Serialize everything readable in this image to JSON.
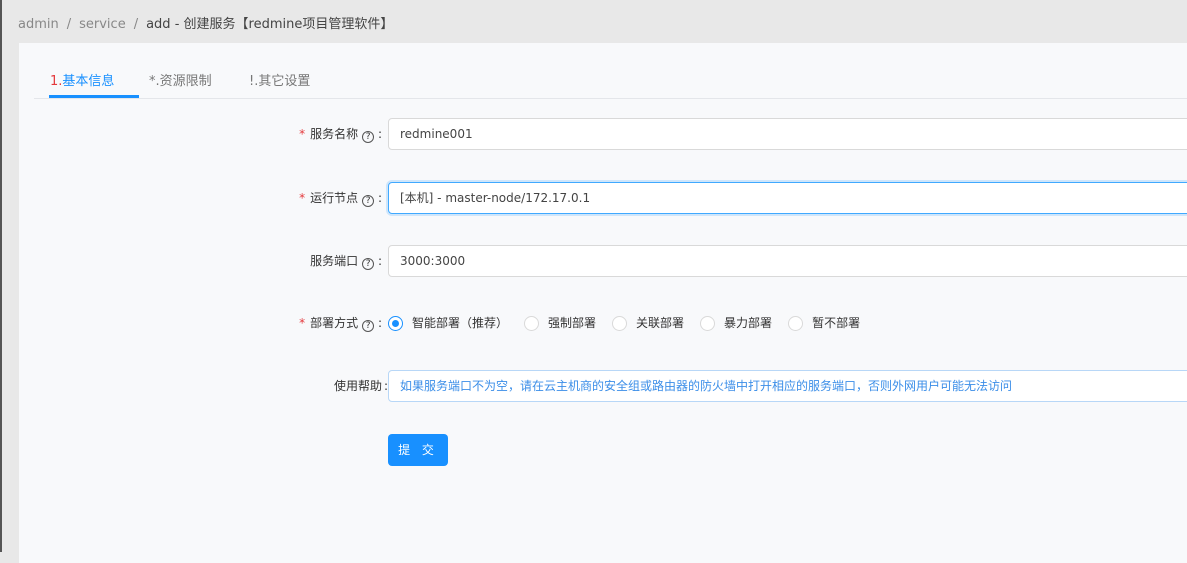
{
  "breadcrumb": {
    "items": [
      "admin",
      "service"
    ],
    "current": "add  -  创建服务【redmine项目管理软件】"
  },
  "tabs": [
    {
      "num": "1.",
      "label": "基本信息"
    },
    {
      "label": "*.资源限制"
    },
    {
      "label": "!.其它设置"
    }
  ],
  "form": {
    "service_name": {
      "label": "服务名称",
      "required": true,
      "value": "redmine001"
    },
    "node": {
      "label": "运行节点",
      "required": true,
      "value": "[本机] - master-node/172.17.0.1"
    },
    "port": {
      "label": "服务端口",
      "value": "3000:3000"
    },
    "deploy": {
      "label": "部署方式",
      "required": true,
      "options": [
        "智能部署（推荐）",
        "强制部署",
        "关联部署",
        "暴力部署",
        "暂不部署"
      ],
      "selected": "智能部署（推荐）"
    },
    "help": {
      "label": "使用帮助",
      "text": "如果服务端口不为空，请在云主机商的安全组或路由器的防火墙中打开相应的服务端口，否则外网用户可能无法访问"
    },
    "submit": "提 交"
  },
  "colors": {
    "accent": "#1890ff",
    "required": "#e4393c"
  }
}
